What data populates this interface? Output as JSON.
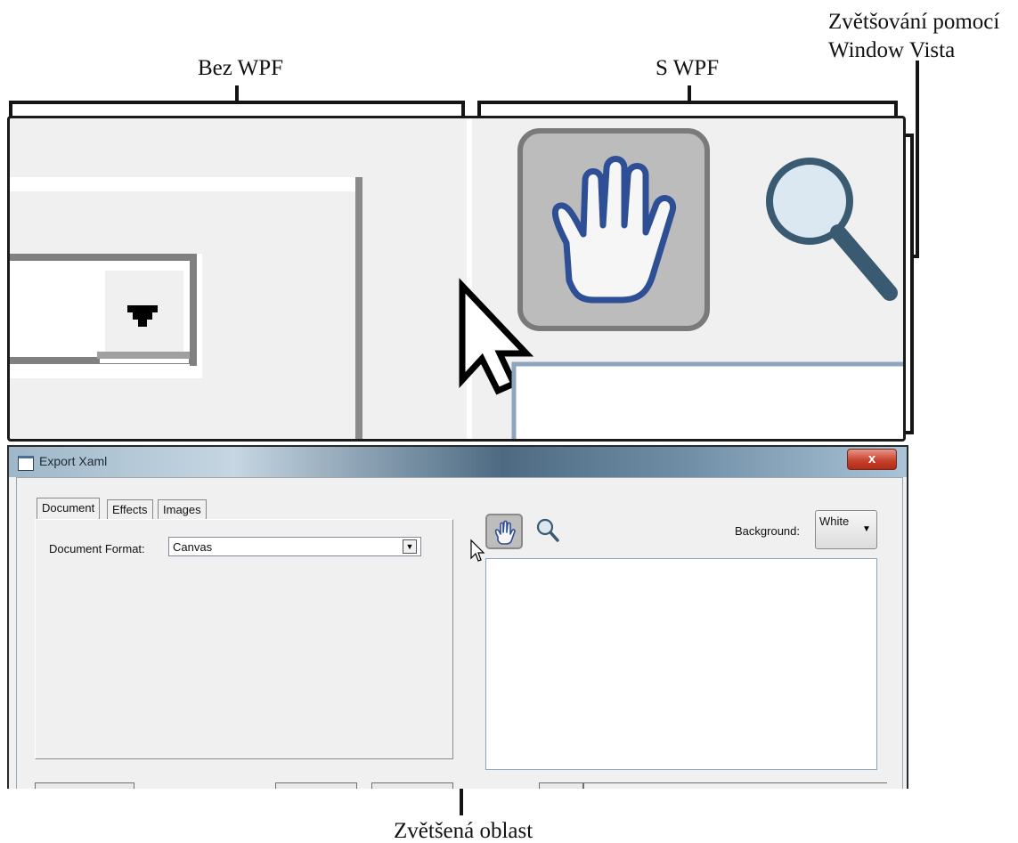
{
  "annotations": {
    "left_label": "Bez WPF",
    "right_label": "S WPF",
    "vista_zoom_label_line1": "Zvětšování pomocí",
    "vista_zoom_label_line2": "Window Vista",
    "zoomed_area_label": "Zvětšená oblast"
  },
  "dialog": {
    "title": "Export Xaml",
    "close_label": "x",
    "tabs": [
      "Document",
      "Effects",
      "Images"
    ],
    "document_format_label": "Document Format:",
    "document_format_value": "Canvas",
    "background_label": "Background:",
    "background_value": "White"
  },
  "icons": [
    "hand-icon",
    "magnifier-icon",
    "dropdown-arrow-icon",
    "mouse-cursor-icon",
    "window-icon"
  ]
}
